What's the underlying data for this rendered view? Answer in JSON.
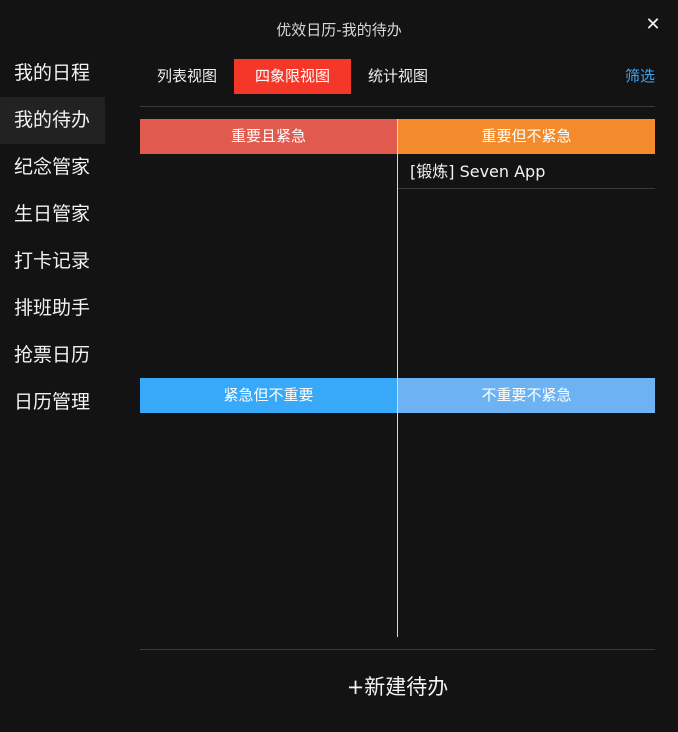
{
  "window": {
    "title": "优效日历-我的待办",
    "close_glyph": "✕"
  },
  "sidebar": {
    "items": [
      {
        "label": "我的日程"
      },
      {
        "label": "我的待办"
      },
      {
        "label": "纪念管家"
      },
      {
        "label": "生日管家"
      },
      {
        "label": "打卡记录"
      },
      {
        "label": "排班助手"
      },
      {
        "label": "抢票日历"
      },
      {
        "label": "日历管理"
      }
    ],
    "active_index": 1
  },
  "tabs": {
    "items": [
      {
        "label": "列表视图"
      },
      {
        "label": "四象限视图"
      },
      {
        "label": "统计视图"
      }
    ],
    "active_index": 1,
    "filter_label": "筛选"
  },
  "quadrants": {
    "q1": {
      "label": "重要且紧急",
      "color": "#e05a4e"
    },
    "q2": {
      "label": "重要但不紧急",
      "color": "#f38a2b",
      "tasks": [
        "[锻炼] Seven App"
      ]
    },
    "q3": {
      "label": "紧急但不重要",
      "color": "#38a8f8"
    },
    "q4": {
      "label": "不重要不紧急",
      "color": "#6db2f2"
    }
  },
  "actions": {
    "new_todo_label": "+新建待办"
  },
  "colors": {
    "background": "#131313",
    "active_tab": "#f5372a",
    "filter_link": "#3ea6f5"
  }
}
